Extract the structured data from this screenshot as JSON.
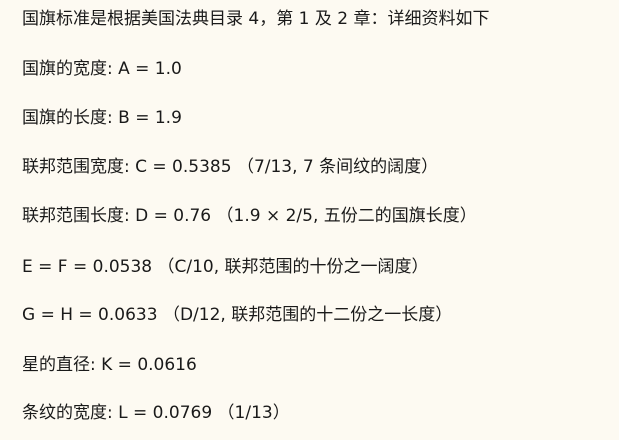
{
  "document": {
    "lines": [
      "国旗标准是根据美国法典目录 4，第 1 及 2 章：详细资料如下",
      "国旗的宽度: A = 1.0",
      "国旗的长度: B = 1.9",
      "联邦范围宽度: C = 0.5385 （7/13, 7 条间纹的阔度）",
      "联邦范围长度: D = 0.76 （1.9 × 2/5, 五份二的国旗长度）",
      "E = F = 0.0538 （C/10, 联邦范围的十份之一阔度）",
      "G = H = 0.0633 （D/12, 联邦范围的十二份之一长度）",
      "星的直径: K = 0.0616",
      "条纹的宽度: L = 0.0769 （1/13）"
    ]
  }
}
